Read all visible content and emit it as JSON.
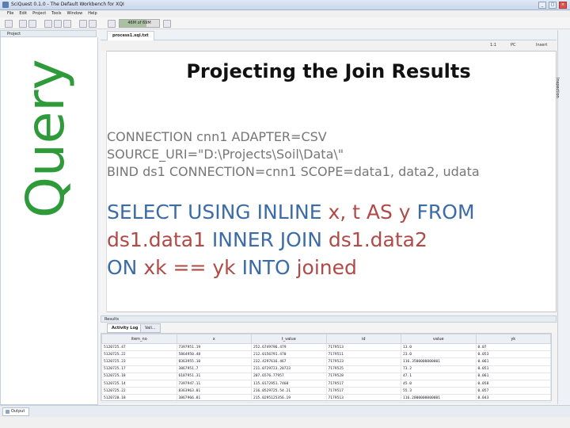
{
  "window": {
    "title": "SciQuest 0.1.0 - The Default Workbench for XQI"
  },
  "menu": [
    "File",
    "Edit",
    "Project",
    "Tools",
    "Window",
    "Help"
  ],
  "memory": {
    "label": "46M of 69M",
    "used_fraction": 0.67
  },
  "project_panel": {
    "title": "Project"
  },
  "side_title": "Query",
  "editor": {
    "tab": "process1.xql.txt",
    "ruler": {
      "position": "1:1",
      "mode": "PC",
      "insert": "Insert"
    },
    "heading": "Projecting the Join Results",
    "connection_lines": [
      "CONNECTION cnn1 ADAPTER=CSV",
      "SOURCE_URI=\"D:\\Projects\\Soil\\Data\\\"",
      "BIND ds1 CONNECTION=cnn1 SCOPE=data1, data2, udata"
    ],
    "sql": {
      "l1_kw1": "SELECT USING INLINE ",
      "l1_id": "x, t AS y",
      "l1_kw2": " FROM",
      "l2_id1": "ds1.data1",
      "l2_kw": " INNER JOIN ",
      "l2_id2": "ds1.data2",
      "l3_kw1": "ON ",
      "l3_id": "xk == yk",
      "l3_kw2": " INTO ",
      "l3_id2": "joined"
    }
  },
  "inspection": {
    "label": "Inspection"
  },
  "results": {
    "title": "Results",
    "tabs": [
      "Activity Log",
      "Vali..."
    ],
    "columns": [
      "item_no",
      "x",
      "t_value",
      "id",
      "value",
      "yk"
    ],
    "rows": [
      [
        "5120725.47",
        "7397951.19",
        "252.6749796.479",
        "7179513",
        "13.0",
        "0.07"
      ],
      [
        "5120725.22",
        "5864950.48",
        "212.0156791.470",
        "7179511",
        "23.0",
        "0.053"
      ],
      [
        "5120725.23",
        "8363955.10",
        "232.4297616.467",
        "7179523",
        "116.3500000000001",
        "0.061"
      ],
      [
        "5120725.17",
        "3867951.7",
        "211.0729723.20723",
        "7179525",
        "73.2",
        "0.051"
      ],
      [
        "5120725.18",
        "6187951.31",
        "207.6576.77957",
        "7179528",
        "47.1",
        "0.061"
      ],
      [
        "5120725.14",
        "7397947.11",
        "115.0172951.7460",
        "7179517",
        "45.0",
        "0.058"
      ],
      [
        "5120725.22",
        "8363963.01",
        "216.0529725.54.21",
        "7179517",
        "55.3",
        "0.057"
      ],
      [
        "5120720.18",
        "3867966.81",
        "215.0295125356.19",
        "7179513",
        "116.2000000000001",
        "0.043"
      ]
    ]
  },
  "status": {
    "output_tab": "Output"
  }
}
